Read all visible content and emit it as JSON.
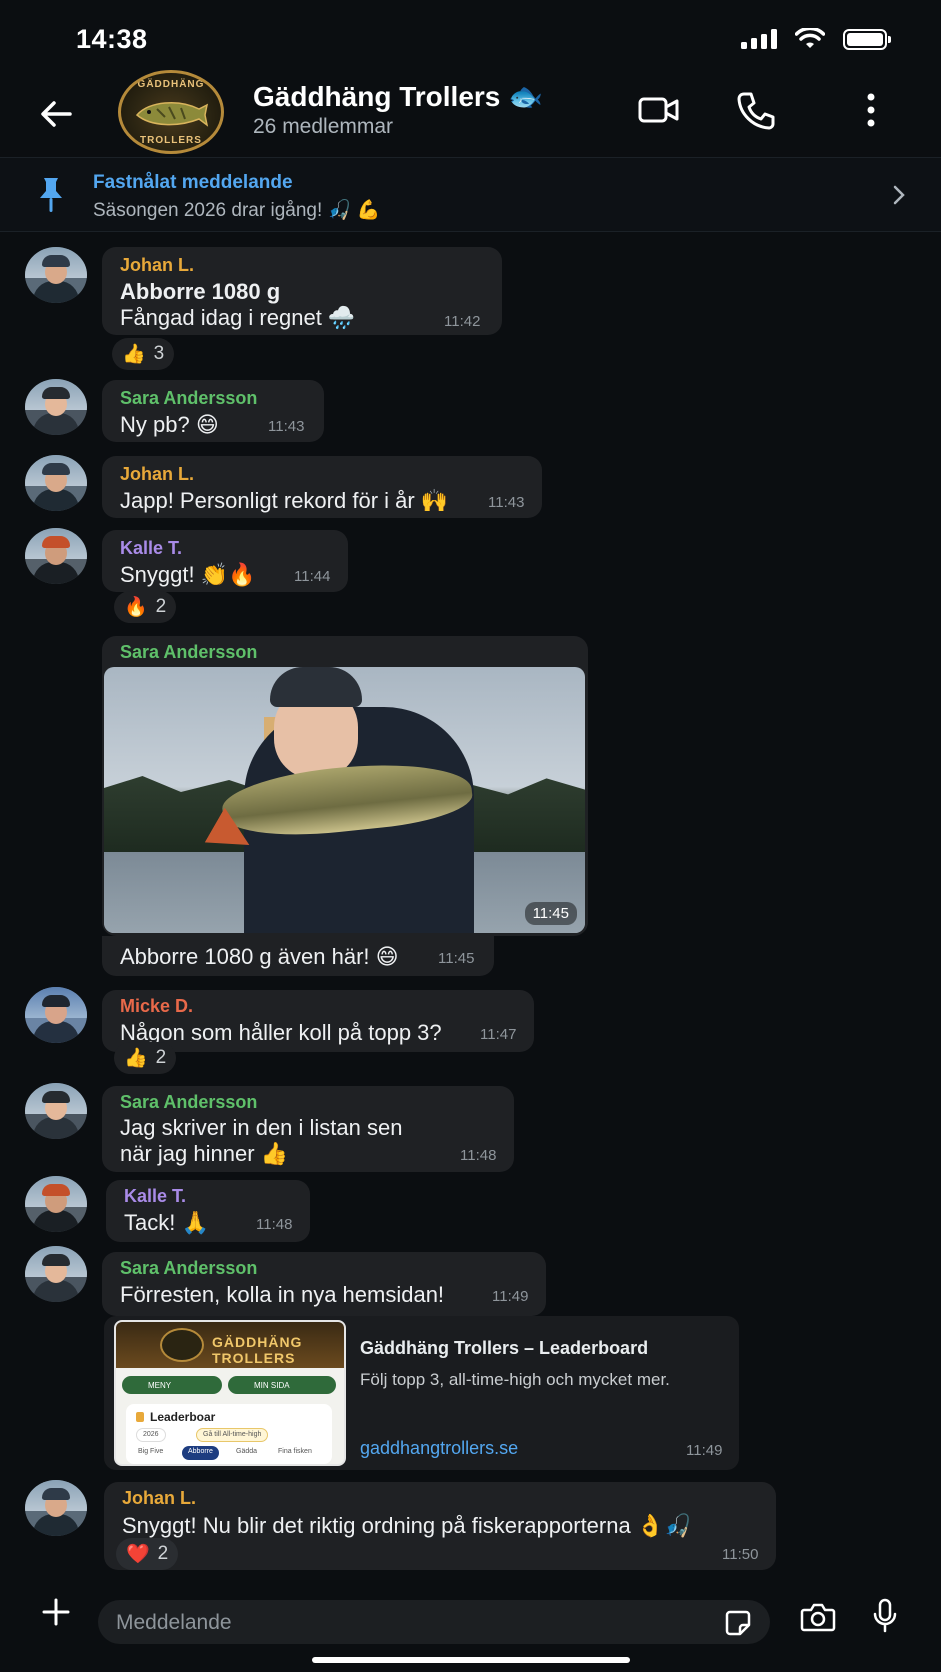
{
  "status": {
    "time": "14:38"
  },
  "header": {
    "title": "Gäddhäng Trollers 🐟",
    "subtitle": "26 medlemmar",
    "avatar_top_text": "GÄDDHÄNG",
    "avatar_bottom_text": "TROLLERS"
  },
  "pinned": {
    "title": "Fastnålat meddelande",
    "text": "Säsongen 2026 drar igång! 🎣 💪"
  },
  "colors": {
    "johan": "#e8a93a",
    "sara": "#5fc06a",
    "kalle": "#a98be8",
    "micke": "#e8694a",
    "link": "#53a7f0"
  },
  "messages": {
    "m1": {
      "sender": "Johan L.",
      "title": "Abborre 1080 g",
      "text": "Fångad idag i regnet 🌧️",
      "time": "11:42",
      "reaction": "👍",
      "reaction_count": "3"
    },
    "m2": {
      "sender": "Sara Andersson",
      "text": "Ny pb? 😄",
      "time": "11:43"
    },
    "m3": {
      "sender": "Johan L.",
      "text": "Japp! Personligt rekord för i år 🙌",
      "time": "11:43"
    },
    "m4": {
      "sender": "Kalle T.",
      "text": "Snyggt! 👏🔥",
      "time": "11:44",
      "reaction": "🔥",
      "reaction_count": "2"
    },
    "m5": {
      "sender": "Sara Andersson",
      "photo_time": "11:45",
      "text": "Abborre 1080 g även här! 😄",
      "time": "11:45"
    },
    "m6": {
      "sender": "Micke D.",
      "text": "Någon som håller koll på topp 3?",
      "time": "11:47",
      "reaction": "👍",
      "reaction_count": "2"
    },
    "m7": {
      "sender": "Sara Andersson",
      "line1": "Jag skriver in den i listan sen",
      "line2": "när jag hinner 👍",
      "time": "11:48"
    },
    "m8": {
      "sender": "Kalle T.",
      "text": "Tack! 🙏",
      "time": "11:48"
    },
    "m9": {
      "sender": "Sara Andersson",
      "text": "Förresten, kolla in nya hemsidan!",
      "time": "11:49",
      "link_title": "Gäddhäng Trollers – Leaderboard",
      "link_desc": "Följ topp 3, all-time-high och mycket mer.",
      "link_url": "gaddhangtrollers.se",
      "link_time": "11:49",
      "thumb": {
        "brand": "GÄDDHÄNG TROLLERS",
        "nav_left": "MENY",
        "nav_right": "MIN SIDA",
        "card_title": "Leaderboar",
        "year": "2026",
        "cta": "Gå till All-time-high",
        "tabs": [
          "Big Five",
          "Abborre",
          "Gädda",
          "Fina fisken"
        ]
      }
    },
    "m10": {
      "sender": "Johan L.",
      "text": "Snyggt! Nu blir det riktig ordning på fiskerapporterna 👌🎣",
      "time": "11:50",
      "reaction": "❤️",
      "reaction_count": "2"
    }
  },
  "input": {
    "placeholder": "Meddelande"
  }
}
